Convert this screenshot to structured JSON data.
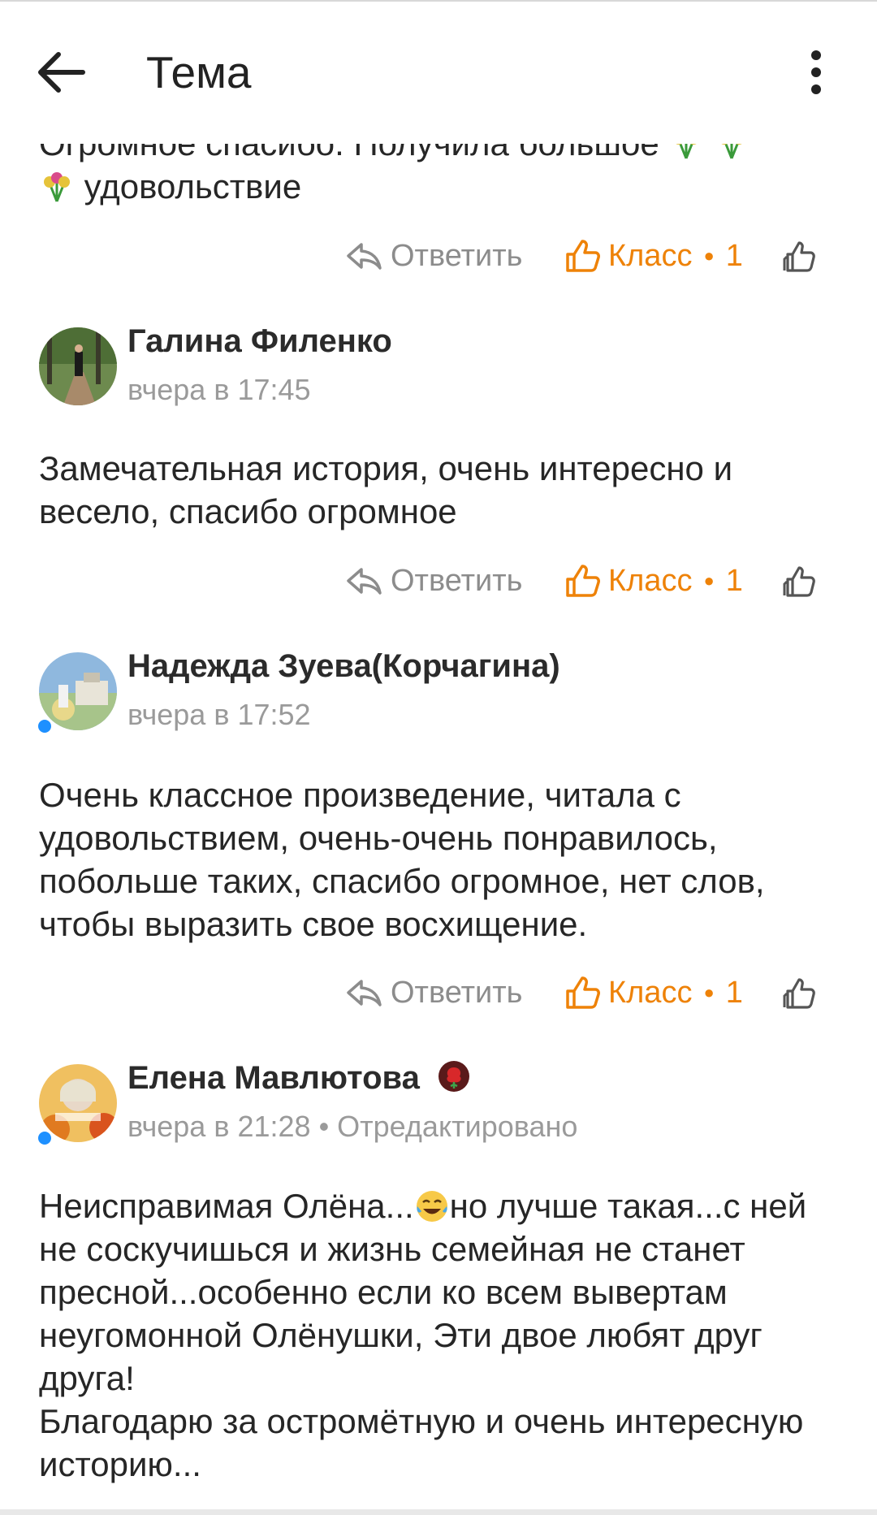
{
  "header": {
    "title": "Тема"
  },
  "first_comment": {
    "text_line1": "Огромное спасибо. Получила большое",
    "text_line2": "удовольствие",
    "reply_label": "Ответить",
    "class_label": "Класс",
    "class_count": "1"
  },
  "comments": [
    {
      "author": "Галина Филенко",
      "time": "вчера в 17:45",
      "text": "Замечательная история, очень интересно и весело, спасибо огромное",
      "reply_label": "Ответить",
      "class_label": "Класс",
      "class_count": "1"
    },
    {
      "author": "Надежда Зуева(Корчагина)",
      "time": "вчера в 17:52",
      "text": "Очень классное произведение, читала с удовольствием, очень-очень понравилось, побольше таких, спасибо огромное, нет слов, чтобы выразить свое восхищение.",
      "reply_label": "Ответить",
      "class_label": "Класс",
      "class_count": "1"
    },
    {
      "author": "Елена Мавлютова",
      "time": "вчера в 21:28",
      "edited": "Отредактировано",
      "text_part1": "Неисправимая Олёна...",
      "text_part2": "но лучше такая...с ней не соскучишься и жизнь семейная не станет пресной...особенно если ко всем вывертам неугомонной Олёнушки, Эти двое любят друг друга!",
      "text_part3": "Благодарю за остромётную и очень интересную историю..."
    }
  ],
  "colors": {
    "accent": "#ee8208",
    "muted": "#9a9a9a",
    "online": "#1e90ff"
  }
}
